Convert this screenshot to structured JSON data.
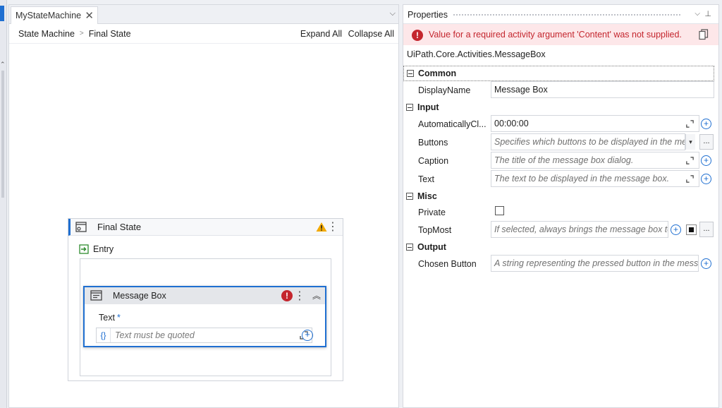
{
  "designer": {
    "tab_title": "MyStateMachine",
    "breadcrumb": [
      "State Machine",
      "Final State"
    ],
    "expand_all": "Expand All",
    "collapse_all": "Collapse All",
    "final_state": {
      "title": "Final State",
      "entry_label": "Entry",
      "message_box": {
        "title": "Message Box",
        "text_label": "Text",
        "required_marker": "*",
        "braces": "{}",
        "text_placeholder": "Text must be quoted"
      }
    }
  },
  "properties": {
    "title": "Properties",
    "error_message": "Value for a required activity argument 'Content' was not supplied.",
    "activity_type": "UiPath.Core.Activities.MessageBox",
    "categories": {
      "common": {
        "label": "Common",
        "display_name_label": "DisplayName",
        "display_name_value": "Message Box"
      },
      "input": {
        "label": "Input",
        "auto_close_label": "AutomaticallyCl...",
        "auto_close_value": "00:00:00",
        "buttons_label": "Buttons",
        "buttons_placeholder": "Specifies which buttons to be displayed in the mes",
        "caption_label": "Caption",
        "caption_placeholder": "The title of the message box dialog.",
        "text_label": "Text",
        "text_placeholder": "The text to be displayed in the message box."
      },
      "misc": {
        "label": "Misc",
        "private_label": "Private",
        "private_checked": false,
        "topmost_label": "TopMost",
        "topmost_placeholder": "If selected, always brings the message box to"
      },
      "output": {
        "label": "Output",
        "chosen_button_label": "Chosen Button",
        "chosen_button_placeholder": "A string representing the pressed button in the messa"
      }
    }
  },
  "colors": {
    "accent": "#1f6fd1",
    "error": "#c4262e",
    "warning": "#f2a900",
    "error_bg": "#fde7e9"
  }
}
